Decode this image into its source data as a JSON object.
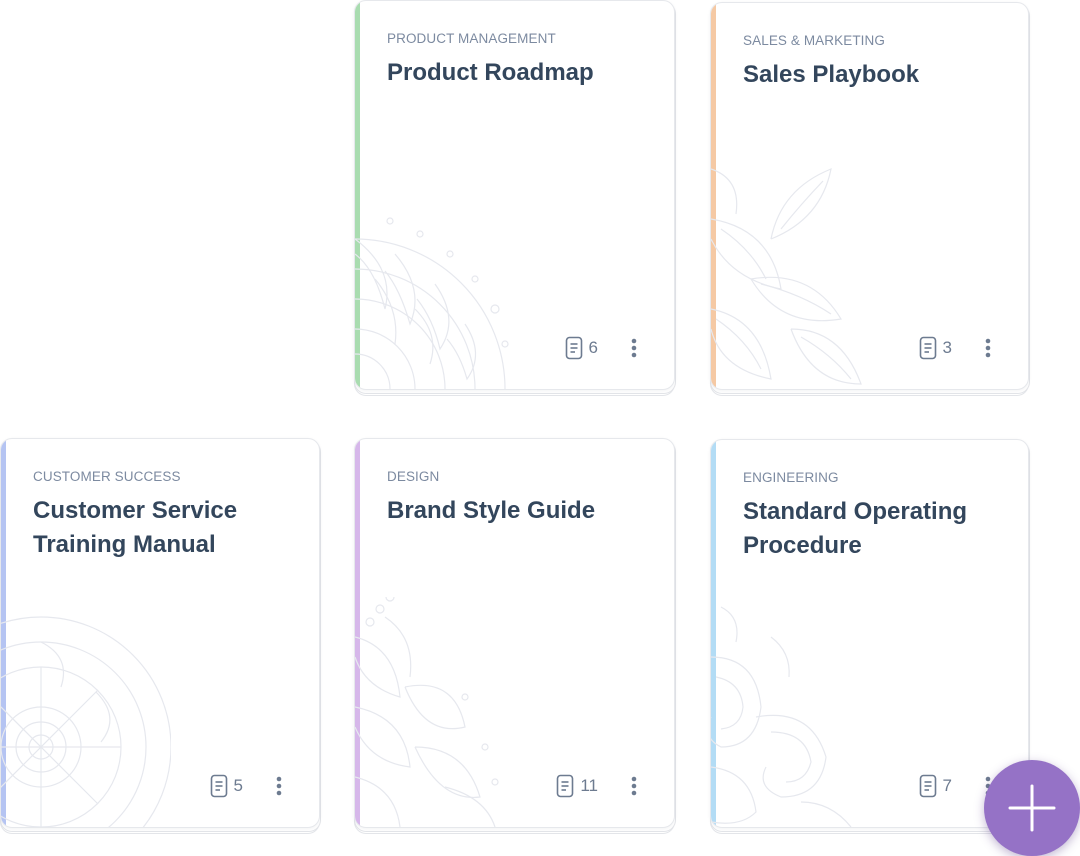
{
  "colors": {
    "title": "#33465c",
    "category": "#7c8aa0",
    "fab": "#9572c6"
  },
  "cards": [
    {
      "category": "PRODUCT MANAGEMENT",
      "title": "Product Roadmap",
      "doc_count": "6",
      "accent": "#a9dcb0",
      "icon": "document-icon",
      "menu_icon": "more-vertical-icon"
    },
    {
      "category": "SALES & MARKETING",
      "title": "Sales Playbook",
      "doc_count": "3",
      "accent": "#f5c9a4",
      "icon": "document-icon",
      "menu_icon": "more-vertical-icon"
    },
    {
      "category": "CUSTOMER SUCCESS",
      "title": "Customer Service Training Manual",
      "doc_count": "5",
      "accent": "#b5c4f2",
      "icon": "document-icon",
      "menu_icon": "more-vertical-icon"
    },
    {
      "category": "DESIGN",
      "title": "Brand Style Guide",
      "doc_count": "11",
      "accent": "#d6b7ea",
      "icon": "document-icon",
      "menu_icon": "more-vertical-icon"
    },
    {
      "category": "ENGINEERING",
      "title": "Standard Operating Procedure",
      "doc_count": "7",
      "accent": "#b3dcf5",
      "icon": "document-icon",
      "menu_icon": "more-vertical-icon"
    }
  ],
  "fab": {
    "icon": "plus-icon"
  }
}
